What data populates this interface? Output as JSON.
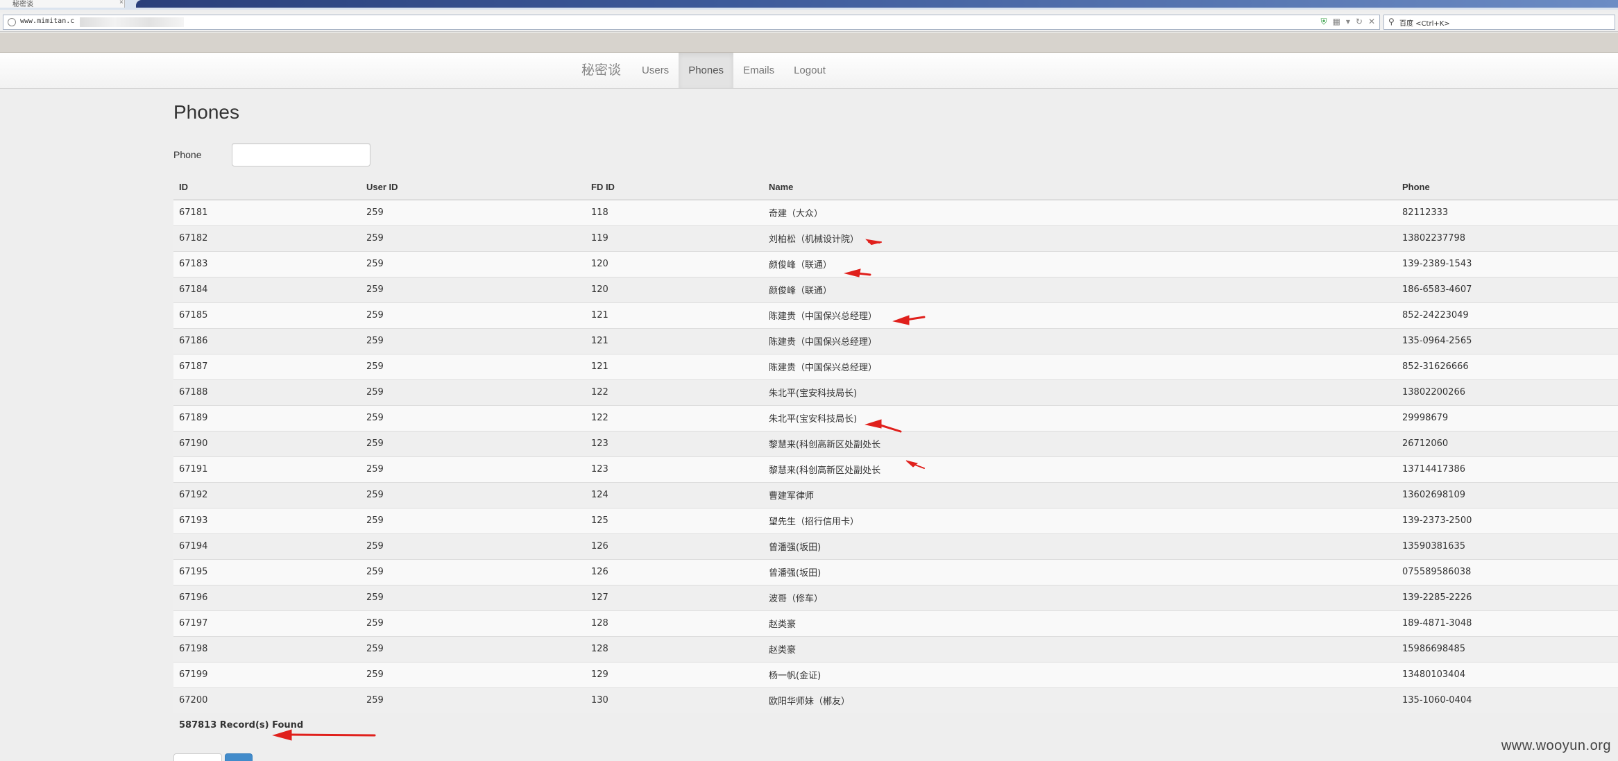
{
  "browser": {
    "tab_title": "秘密谈",
    "url": "www.mimitan.c",
    "search_placeholder": "百度 <Ctrl+K>"
  },
  "nav": {
    "brand": "秘密谈",
    "items": [
      {
        "label": "Users",
        "active": false
      },
      {
        "label": "Phones",
        "active": true
      },
      {
        "label": "Emails",
        "active": false
      },
      {
        "label": "Logout",
        "active": false
      }
    ]
  },
  "page": {
    "title": "Phones",
    "filter_label": "Phone",
    "filter_value": ""
  },
  "table": {
    "headers": [
      "ID",
      "User ID",
      "FD ID",
      "Name",
      "Phone"
    ],
    "rows": [
      [
        "67181",
        "259",
        "118",
        "奇建（大众）",
        "82112333"
      ],
      [
        "67182",
        "259",
        "119",
        "刘柏松（机械设计院）",
        "13802237798"
      ],
      [
        "67183",
        "259",
        "120",
        "颜俊峰（联通）",
        "139-2389-1543"
      ],
      [
        "67184",
        "259",
        "120",
        "颜俊峰（联通）",
        "186-6583-4607"
      ],
      [
        "67185",
        "259",
        "121",
        "陈建贵（中国保兴总经理）",
        "852-24223049"
      ],
      [
        "67186",
        "259",
        "121",
        "陈建贵（中国保兴总经理）",
        "135-0964-2565"
      ],
      [
        "67187",
        "259",
        "121",
        "陈建贵（中国保兴总经理）",
        "852-31626666"
      ],
      [
        "67188",
        "259",
        "122",
        "朱北平(宝安科技局长)",
        "13802200266"
      ],
      [
        "67189",
        "259",
        "122",
        "朱北平(宝安科技局长)",
        "29998679"
      ],
      [
        "67190",
        "259",
        "123",
        "黎慧来(科创高新区处副处长",
        "26712060"
      ],
      [
        "67191",
        "259",
        "123",
        "黎慧来(科创高新区处副处长",
        "13714417386"
      ],
      [
        "67192",
        "259",
        "124",
        "曹建军律师",
        "13602698109"
      ],
      [
        "67193",
        "259",
        "125",
        "望先生（招行信用卡）",
        "139-2373-2500"
      ],
      [
        "67194",
        "259",
        "126",
        "曾潘强(坂田)",
        "13590381635"
      ],
      [
        "67195",
        "259",
        "126",
        "曾潘强(坂田)",
        "075589586038"
      ],
      [
        "67196",
        "259",
        "127",
        "波哥（修车）",
        "139-2285-2226"
      ],
      [
        "67197",
        "259",
        "128",
        "赵类豪",
        "189-4871-3048"
      ],
      [
        "67198",
        "259",
        "128",
        "赵类豪",
        "15986698485"
      ],
      [
        "67199",
        "259",
        "129",
        "杨一帆(金证)",
        "13480103404"
      ],
      [
        "67200",
        "259",
        "130",
        "欧阳华师妹（郴友）",
        "135-1060-0404"
      ]
    ]
  },
  "records_found": "587813 Record(s) Found",
  "watermark": "www.wooyun.org",
  "colors": {
    "annotation_arrow": "#e0201c",
    "pager_button": "#428bca"
  }
}
